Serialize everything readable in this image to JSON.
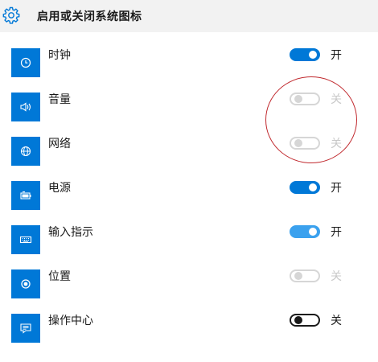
{
  "header": {
    "title": "启用或关闭系统图标",
    "icon": "gear-icon"
  },
  "items": [
    {
      "label": "时钟",
      "icon": "clock-icon",
      "state": "on",
      "state_label": "开"
    },
    {
      "label": "音量",
      "icon": "volume-icon",
      "state": "off-disabled",
      "state_label": "关"
    },
    {
      "label": "网络",
      "icon": "globe-icon",
      "state": "off-disabled",
      "state_label": "关"
    },
    {
      "label": "电源",
      "icon": "battery-icon",
      "state": "on",
      "state_label": "开"
    },
    {
      "label": "输入指示",
      "icon": "keyboard-icon",
      "state": "on-light",
      "state_label": "开"
    },
    {
      "label": "位置",
      "icon": "location-icon",
      "state": "off-disabled",
      "state_label": "关"
    },
    {
      "label": "操作中心",
      "icon": "action-center-icon",
      "state": "off",
      "state_label": "关"
    }
  ],
  "colors": {
    "accent": "#0078d7",
    "accent_light": "#3ba1ee",
    "disabled": "#d6d6d6",
    "annotation": "#c0282d"
  }
}
